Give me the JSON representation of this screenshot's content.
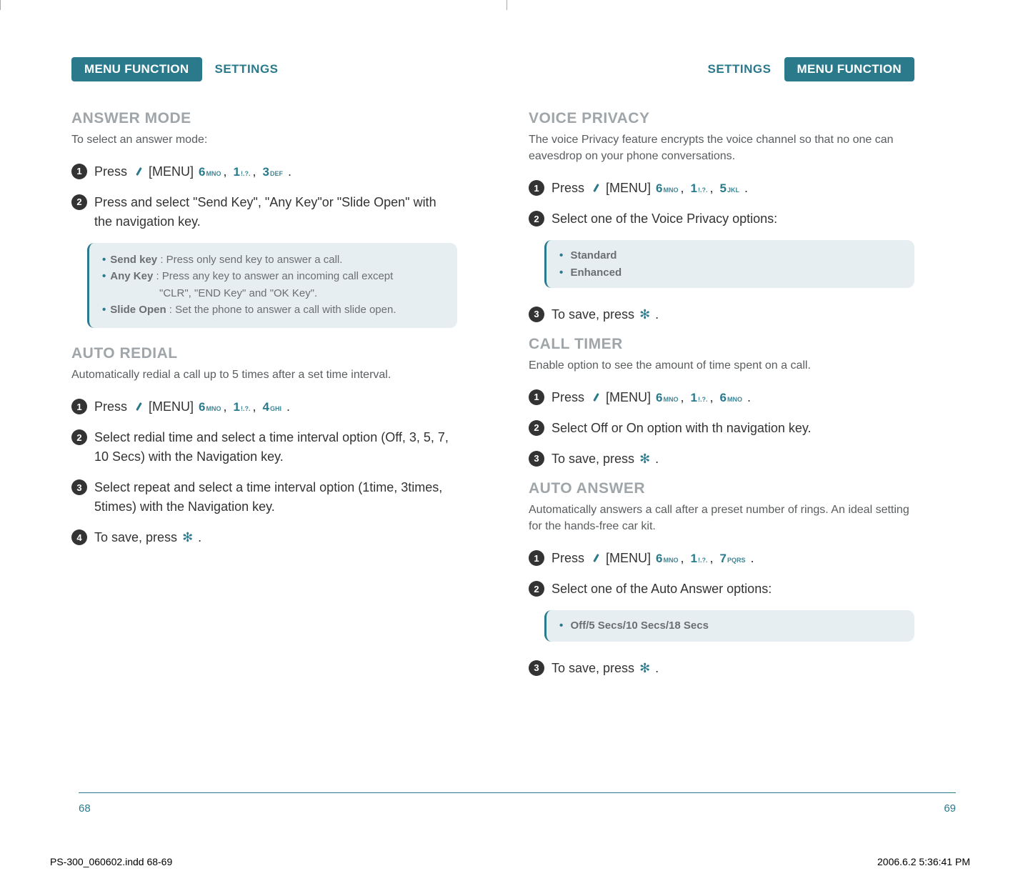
{
  "header": {
    "pill": "MENU FUNCTION",
    "sub": "SETTINGS"
  },
  "left": {
    "answer_mode": {
      "title": "ANSWER MODE",
      "sub": "To select an answer mode:",
      "step1_prefix": "Press ",
      "step1_menu": "[MENU] ",
      "keys": [
        "6 MNO",
        "1 !.?.",
        "3 DEF"
      ],
      "step1_suffix": ".",
      "step2": "Press and select \"Send Key\", \"Any Key\"or \"Slide Open\" with the navigation key.",
      "note": {
        "items": [
          {
            "label": "Send key",
            "text": ": Press only send key to answer a call."
          },
          {
            "label": "Any Key",
            "text": ": Press any key to answer an incoming call except",
            "cont": "\"CLR\", \"END Key\" and \"OK Key\"."
          },
          {
            "label": "Slide Open",
            "text": ": Set the phone to answer a call with slide open."
          }
        ]
      }
    },
    "auto_redial": {
      "title": "AUTO REDIAL",
      "sub": "Automatically redial a call up to 5 times after a set time interval.",
      "step1_prefix": "Press ",
      "step1_menu": "[MENU] ",
      "keys": [
        "6 MNO",
        "1 !.?.",
        "4 GHI"
      ],
      "step1_suffix": ".",
      "step2": "Select redial time and select a time interval option (Off, 3, 5, 7, 10 Secs) with the Navigation key.",
      "step3": "Select repeat and select a time interval option (1time, 3times, 5times) with the Navigation key.",
      "step4_prefix": "To save, press ",
      "step4_suffix": "."
    }
  },
  "right": {
    "voice_privacy": {
      "title": "VOICE PRIVACY",
      "sub": "The voice Privacy feature encrypts the voice channel so that no one can eavesdrop on your phone conversations.",
      "step1_prefix": "Press ",
      "step1_menu": "[MENU] ",
      "keys": [
        "6 MNO",
        "1 !.?.",
        "5 JKL"
      ],
      "step1_suffix": ".",
      "step2": "Select one of the Voice Privacy options:",
      "note_items": [
        "Standard",
        "Enhanced"
      ],
      "step3_prefix": "To save, press ",
      "step3_suffix": "."
    },
    "call_timer": {
      "title": "CALL TIMER",
      "sub": "Enable option to see the amount of time spent on a call.",
      "step1_prefix": "Press ",
      "step1_menu": "[MENU] ",
      "keys": [
        "6 MNO",
        "1 !.?.",
        "6 MNO"
      ],
      "step1_suffix": ".",
      "step2": "Select Off or On option with th navigation key.",
      "step3_prefix": "To save, press ",
      "step3_suffix": "."
    },
    "auto_answer": {
      "title": "AUTO ANSWER",
      "sub": "Automatically answers a call after a preset number of rings. An ideal setting for the hands-free car kit.",
      "step1_prefix": "Press ",
      "step1_menu": "[MENU] ",
      "keys": [
        "6 MNO",
        "1 !.?.",
        "7 PQRS"
      ],
      "step1_suffix": ".",
      "step2": "Select one of the Auto Answer options:",
      "note_items": [
        "Off/5 Secs/10 Secs/18 Secs"
      ],
      "step3_prefix": "To save, press ",
      "step3_suffix": "."
    }
  },
  "page_numbers": {
    "left": "68",
    "right": "69"
  },
  "footer": {
    "left": "PS-300_060602.indd   68-69",
    "right": "2006.6.2   5:36:41 PM"
  }
}
